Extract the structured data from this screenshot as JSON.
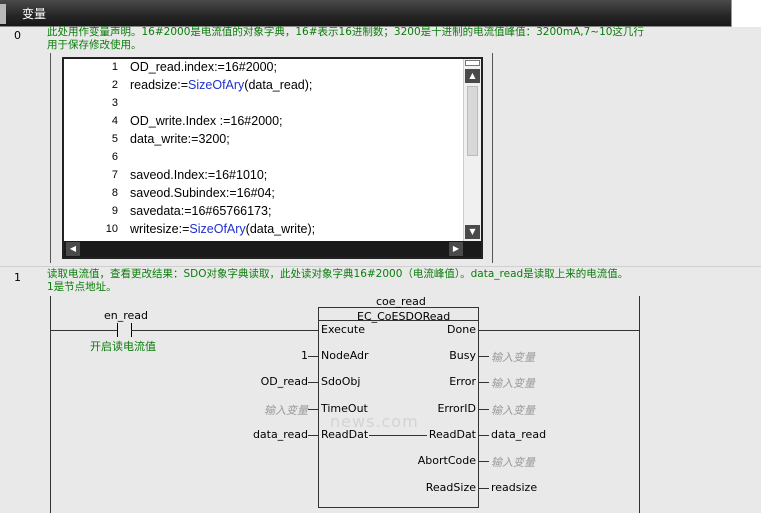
{
  "header": {
    "title": "变量"
  },
  "rung0": {
    "number": "0",
    "comment_line1": "此处用作变量声明。16#2000是电流值的对象字典，16#表示16进制数；3200是十进制的电流值峰值：3200mA,7~10这几行",
    "comment_line2": "用于保存修改使用。",
    "code": [
      {
        "n": "1",
        "pre": "OD_read.index:=16#2000;",
        "fn": "",
        "post": ""
      },
      {
        "n": "2",
        "pre": "readsize:=",
        "fn": "SizeOfAry",
        "post": "(data_read);"
      },
      {
        "n": "3",
        "pre": "",
        "fn": "",
        "post": ""
      },
      {
        "n": "4",
        "pre": "OD_write.Index :=16#2000;",
        "fn": "",
        "post": ""
      },
      {
        "n": "5",
        "pre": "data_write:=3200;",
        "fn": "",
        "post": ""
      },
      {
        "n": "6",
        "pre": "",
        "fn": "",
        "post": ""
      },
      {
        "n": "7",
        "pre": "saveod.Index:=16#1010;",
        "fn": "",
        "post": ""
      },
      {
        "n": "8",
        "pre": "saveod.Subindex:=16#04;",
        "fn": "",
        "post": ""
      },
      {
        "n": "9",
        "pre": "savedata:=16#65766173;",
        "fn": "",
        "post": ""
      },
      {
        "n": "10",
        "pre": "writesize:=",
        "fn": "SizeOfAry",
        "post": "(data_write);"
      }
    ]
  },
  "rung1": {
    "number": "1",
    "comment_line1": "读取电流值，查看更改结果：SDO对象字典读取，此处读对象字典16#2000（电流峰值）。data_read是读取上来的电流值。",
    "comment_line2": "1是节点地址。",
    "contact": {
      "name": "en_read",
      "comment": "开启读电流值"
    },
    "block": {
      "instance": "coe_read",
      "type": "EC_CoESDORead",
      "in_pins": [
        "Execute",
        "NodeAdr",
        "SdoObj",
        "TimeOut",
        "ReadDat"
      ],
      "in_vars": [
        "",
        "1",
        "OD_read",
        "输入变量",
        "data_read"
      ],
      "out_pins": [
        "Done",
        "Busy",
        "Error",
        "ErrorID",
        "ReadDat",
        "AbortCode",
        "ReadSize"
      ],
      "out_vars": [
        "",
        "输入变量",
        "输入变量",
        "输入变量",
        "data_read",
        "输入变量",
        "readsize"
      ]
    }
  },
  "watermark": "news.com"
}
